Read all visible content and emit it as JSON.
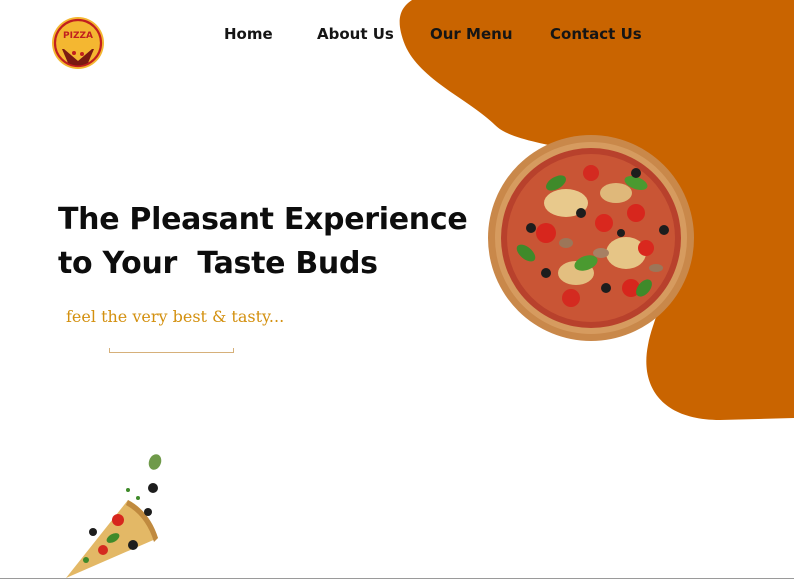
{
  "logo": {
    "lettering": "PIZZA",
    "icon": "pizza-logo-icon",
    "badge_color": "#f4b731",
    "ring_color": "#c11f1f"
  },
  "nav": {
    "items": [
      {
        "label": "Home"
      },
      {
        "label": "About Us"
      },
      {
        "label": "Our Menu"
      },
      {
        "label": "Contact Us"
      }
    ]
  },
  "hero": {
    "headline_line1": "The Pleasant Experience",
    "headline_line2": "to Your  Taste Buds",
    "tagline": "feel the very best & tasty...",
    "pizza_image": "whole-pizza-icon",
    "slice_image": "pizza-slice-icon"
  },
  "colors": {
    "accent": "#c96400",
    "tagline": "#d3900f",
    "text": "#0d0d0d"
  }
}
